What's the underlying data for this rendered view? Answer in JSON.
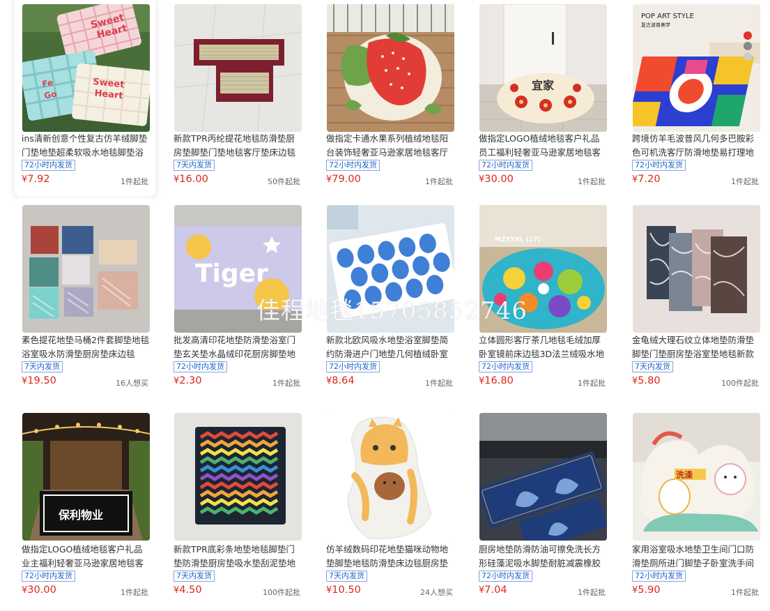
{
  "watermark": "佳程地毯15705852746",
  "products": [
    {
      "title": "ins清新创意个性复古仿羊绒脚垫门垫地垫超柔软吸水地毯脚垫浴室",
      "badge": "72小时内发货",
      "price": "7.92",
      "moq": "1件起批",
      "image_label": "Sweet Heart"
    },
    {
      "title": "新款TPR丙纶提花地毯防滑垫厨房垫脚垫门垫地毯客厅垫床边毯",
      "badge": "7天内发货",
      "price": "16.00",
      "moq": "50件起批"
    },
    {
      "title": "做指定卡通水果系列植绒地毯阳台装饰轻奢亚马逊家居地毯客厅",
      "badge": "72小时内发货",
      "price": "79.00",
      "moq": "1件起批"
    },
    {
      "title": "做指定LOGO植绒地毯客户礼品员工福利轻奢亚马逊家居地毯客厅",
      "badge": "72小时内发货",
      "price": "30.00",
      "moq": "1件起批",
      "image_label": "宜家"
    },
    {
      "title": "跨境仿羊毛波普风几何多巴胺彩色可机洗客厅防滑地垫易打理地毯",
      "badge": "72小时内发货",
      "price": "7.20",
      "moq": "1件起批",
      "image_label": "POP ART STYLE",
      "image_sublabel": "复古波普美学"
    },
    {
      "title": "素色提花地垫马桶2件套脚垫地毯浴室吸水防滑垫厨房垫床边毯",
      "badge": "7天内发货",
      "price": "19.50",
      "moq": "16人想买"
    },
    {
      "title": "批发高清印花地垫防滑垫浴室门垫玄关垫水晶绒印花厨房脚垫地毯",
      "badge": "72小时内发货",
      "price": "2.30",
      "moq": "1件起批",
      "image_label": "Tiger"
    },
    {
      "title": "新款北欧风吸水地垫浴室脚垫简约防滑进户门地垫几何植绒卧室",
      "badge": "72小时内发货",
      "price": "8.64",
      "moq": "1件起批"
    },
    {
      "title": "立体圆形客厅茶几地毯毛绒加厚卧室镜前床边毯3D法兰绒吸水地垫",
      "badge": "72小时内发货",
      "price": "16.80",
      "moq": "1件起批",
      "image_label": "MZYXXL (27)"
    },
    {
      "title": "金龟绒大理石纹立体地垫防滑垫脚垫门垫厨房垫浴室垫地毯新款",
      "badge": "7天内发货",
      "price": "5.80",
      "moq": "100件起批"
    },
    {
      "title": "做指定LOGO植绒地毯客户礼品业主福利轻奢亚马逊家居地毯客厅",
      "badge": "72小时内发货",
      "price": "30.00",
      "moq": "1件起批",
      "image_label": "保利物业"
    },
    {
      "title": "新款TPR底彩条地垫地毯脚垫门垫防滑垫厨房垫吸水垫刮泥垫地毯",
      "badge": "7天内发货",
      "price": "4.50",
      "moq": "100件起批"
    },
    {
      "title": "仿羊绒数码印花地垫猫咪动物地垫脚垫地毯防滑垫床边毯厨房垫",
      "badge": "7天内发货",
      "price": "10.50",
      "moq": "24人想买"
    },
    {
      "title": "厨房地垫防滑防油可擦免洗长方形硅藻泥吸水脚垫耐脏减震橡胶",
      "badge": "72小时内发货",
      "price": "7.04",
      "moq": "1件起批"
    },
    {
      "title": "家用浴室吸水地垫卫生间门口防滑垫厕所进门脚垫子卧室洗手间",
      "badge": "72小时内发货",
      "price": "5.90",
      "moq": "1件起批",
      "image_label": "洗澡"
    }
  ],
  "currency": "¥",
  "colors": {
    "price": "#e1251b",
    "badge": "#1f63c7"
  }
}
